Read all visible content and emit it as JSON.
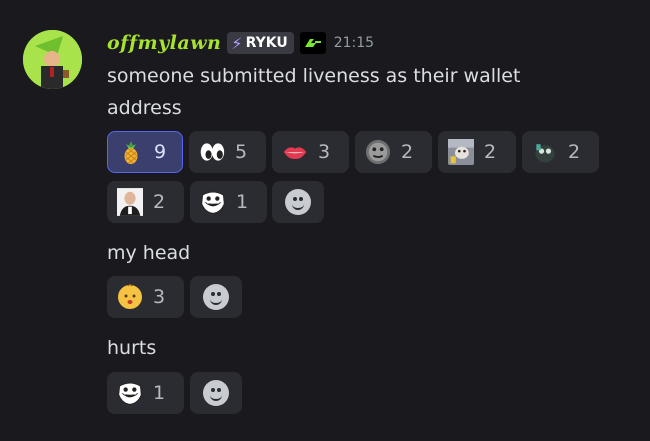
{
  "message": {
    "author": "offmylawn",
    "server_tag": "RYKU",
    "timestamp": "21:15",
    "lines": [
      {
        "text": "someone submitted liveness as their wallet"
      },
      {
        "text": "address"
      },
      {
        "text": "my head"
      },
      {
        "text": "hurts"
      }
    ]
  },
  "reactions": {
    "group1": [
      {
        "emoji": "pineapple",
        "count": "9",
        "selected": true
      },
      {
        "emoji": "eyes",
        "count": "5"
      },
      {
        "emoji": "lips",
        "count": "3"
      },
      {
        "emoji": "thomas-face",
        "count": "2"
      },
      {
        "emoji": "cat-meme",
        "count": "2"
      },
      {
        "emoji": "dog-meme",
        "count": "2"
      },
      {
        "emoji": "bald-man",
        "count": "2"
      },
      {
        "emoji": "trollface",
        "count": "1"
      }
    ],
    "group2": [
      {
        "emoji": "baby-face",
        "count": "3"
      }
    ],
    "group3": [
      {
        "emoji": "trollface",
        "count": "1"
      }
    ]
  },
  "colors": {
    "background": "#1a1a1e",
    "username": "#a6e22e",
    "reaction_selected_border": "#5865f2"
  }
}
